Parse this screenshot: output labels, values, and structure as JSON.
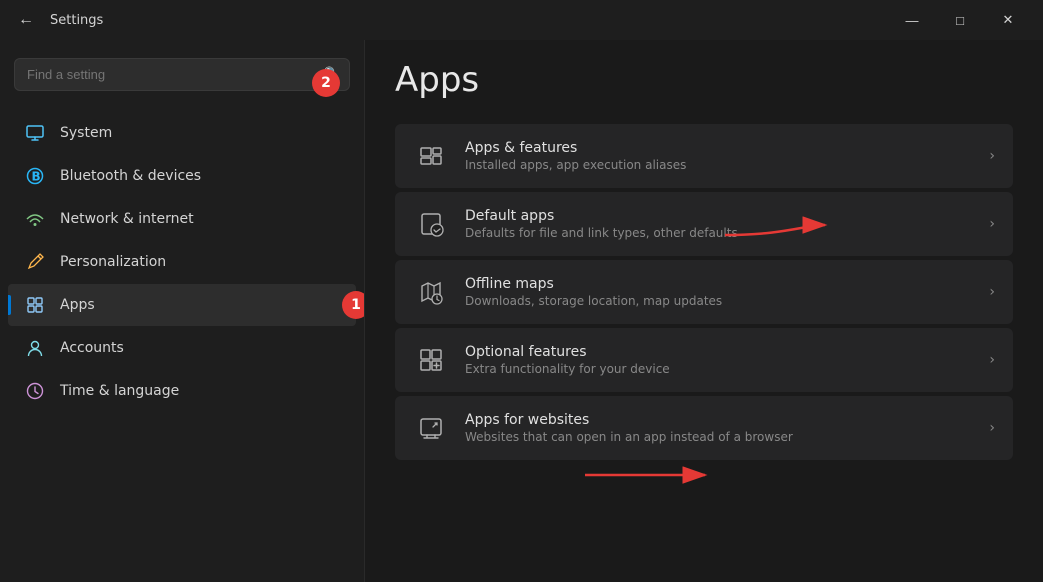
{
  "titlebar": {
    "title": "Settings",
    "back_label": "←",
    "minimize": "—",
    "maximize": "□",
    "close": "✕"
  },
  "sidebar": {
    "search_placeholder": "Find a setting",
    "items": [
      {
        "id": "system",
        "label": "System",
        "icon": "💻",
        "icon_class": "icon-system",
        "active": false
      },
      {
        "id": "bluetooth",
        "label": "Bluetooth & devices",
        "icon": "⬤",
        "icon_class": "icon-bluetooth",
        "active": false
      },
      {
        "id": "network",
        "label": "Network & internet",
        "icon": "◈",
        "icon_class": "icon-network",
        "active": false
      },
      {
        "id": "personalization",
        "label": "Personalization",
        "icon": "✏",
        "icon_class": "icon-personalization",
        "active": false
      },
      {
        "id": "apps",
        "label": "Apps",
        "icon": "⊞",
        "icon_class": "icon-apps",
        "active": true
      },
      {
        "id": "accounts",
        "label": "Accounts",
        "icon": "◉",
        "icon_class": "icon-accounts",
        "active": false
      },
      {
        "id": "time",
        "label": "Time & language",
        "icon": "◷",
        "icon_class": "icon-time",
        "active": false
      }
    ]
  },
  "main": {
    "page_title": "Apps",
    "items": [
      {
        "id": "apps-features",
        "title": "Apps & features",
        "desc": "Installed apps, app execution aliases",
        "icon": "apps-features-icon"
      },
      {
        "id": "default-apps",
        "title": "Default apps",
        "desc": "Defaults for file and link types, other defaults",
        "icon": "default-apps-icon"
      },
      {
        "id": "offline-maps",
        "title": "Offline maps",
        "desc": "Downloads, storage location, map updates",
        "icon": "offline-maps-icon"
      },
      {
        "id": "optional-features",
        "title": "Optional features",
        "desc": "Extra functionality for your device",
        "icon": "optional-features-icon"
      },
      {
        "id": "apps-websites",
        "title": "Apps for websites",
        "desc": "Websites that can open in an app instead of a browser",
        "icon": "apps-websites-icon"
      }
    ]
  },
  "annotations": {
    "circle1_label": "1",
    "circle2_label": "2"
  }
}
